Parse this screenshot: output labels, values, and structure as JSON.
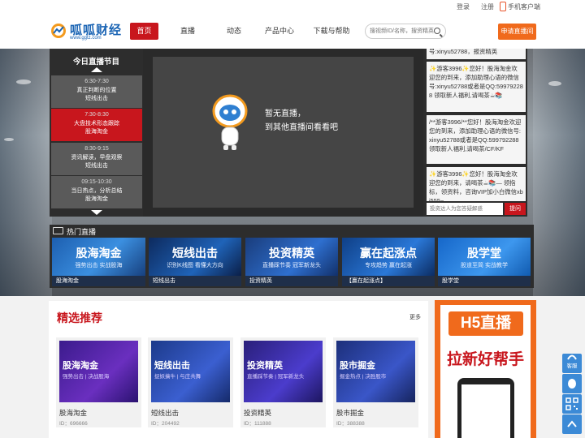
{
  "topbar": {
    "login": "登录",
    "register": "注册",
    "mobile": "手机客户端"
  },
  "header": {
    "logo_name": "呱呱财经",
    "logo_url": "www.ggtz.com",
    "nav": [
      "首页",
      "直播",
      "动态",
      "产品中心",
      "下载与帮助"
    ],
    "search_placeholder": "搜视频ID/名称，搜资精英",
    "apply_button": "申请直播间"
  },
  "schedule": {
    "title": "今日直播节目",
    "slots": [
      {
        "time": "6:30-7:30",
        "topic": "真正判断的位置",
        "room": "短线出击",
        "active": false
      },
      {
        "time": "7:30-8:30",
        "topic": "大盘技术形态跟踪",
        "room": "股海淘金",
        "active": true
      },
      {
        "time": "8:30-9:15",
        "topic": "资讯解读，早盘观察",
        "room": "短线出击",
        "active": false
      },
      {
        "time": "09:15-10:30",
        "topic": "当日热点，分析总结",
        "room": "股海淘金",
        "active": false
      }
    ]
  },
  "player": {
    "line1": "暂无直播，",
    "line2": "到其他直播间看看吧"
  },
  "chat": {
    "top_fragment": "号:xinyu52788，报资精英",
    "messages": [
      "✨游客3996✨您好！股海淘金欢迎您的到来，添加助理心语的微信号:xinyu52788或者是QQ:599792288 领取新人福利,请喝茶☕📚",
      "/**游客3996/**您好！股海淘金欢迎您的到来，添加助理心语的微信号:xinyu52788或者是QQ:599792288 领取新人福利,请喝茶/CF/KF",
      "✨游客3996✨您好！股海淘金欢迎您的到来，请喝茶☕📚— 领指标，领资料，咨询VIP加小白微信xbj555~"
    ],
    "input_placeholder": "投资达人为您答疑解惑",
    "send": "提问"
  },
  "hot": {
    "title": "热门直播",
    "cards": [
      {
        "big": "股海淘金",
        "small": "强势出击 实战股海",
        "caption": "股海淘金"
      },
      {
        "big": "短线出击",
        "small": "识别K线图 看懂大方向",
        "caption": "短线出击"
      },
      {
        "big": "投资精英",
        "small": "直播踩节奏 冠军新龙头",
        "caption": "投资精英"
      },
      {
        "big": "赢在起涨点",
        "small": "专攻趋势 赢在起涨",
        "caption": "【赢在起涨点】"
      },
      {
        "big": "股学堂",
        "small": "股道至简 实战教学",
        "caption": "股学堂"
      }
    ]
  },
  "picks": {
    "title": "精选推荐",
    "more": "更多",
    "cards": [
      {
        "big": "股海淘金",
        "small": "强势出击 | 决战股海",
        "name": "股海淘金",
        "id": "ID：696666"
      },
      {
        "big": "短线出击",
        "small": "捉妖擒牛 | 与庄共舞",
        "name": "短线出击",
        "id": "ID：204492"
      },
      {
        "big": "投资精英",
        "small": "直播踩节奏 | 冠军新龙头",
        "name": "投资精英",
        "id": "ID：111888"
      },
      {
        "big": "股市掘金",
        "small": "掘金热点 | 决胜股市",
        "name": "股市掘金",
        "id": "ID：388388"
      }
    ]
  },
  "ad": {
    "line1": "H5直播",
    "line2": "拉新好帮手"
  },
  "float_bar": {
    "service": "客服",
    "qq": "QQ",
    "qr": "二维码",
    "top": "顶部"
  }
}
